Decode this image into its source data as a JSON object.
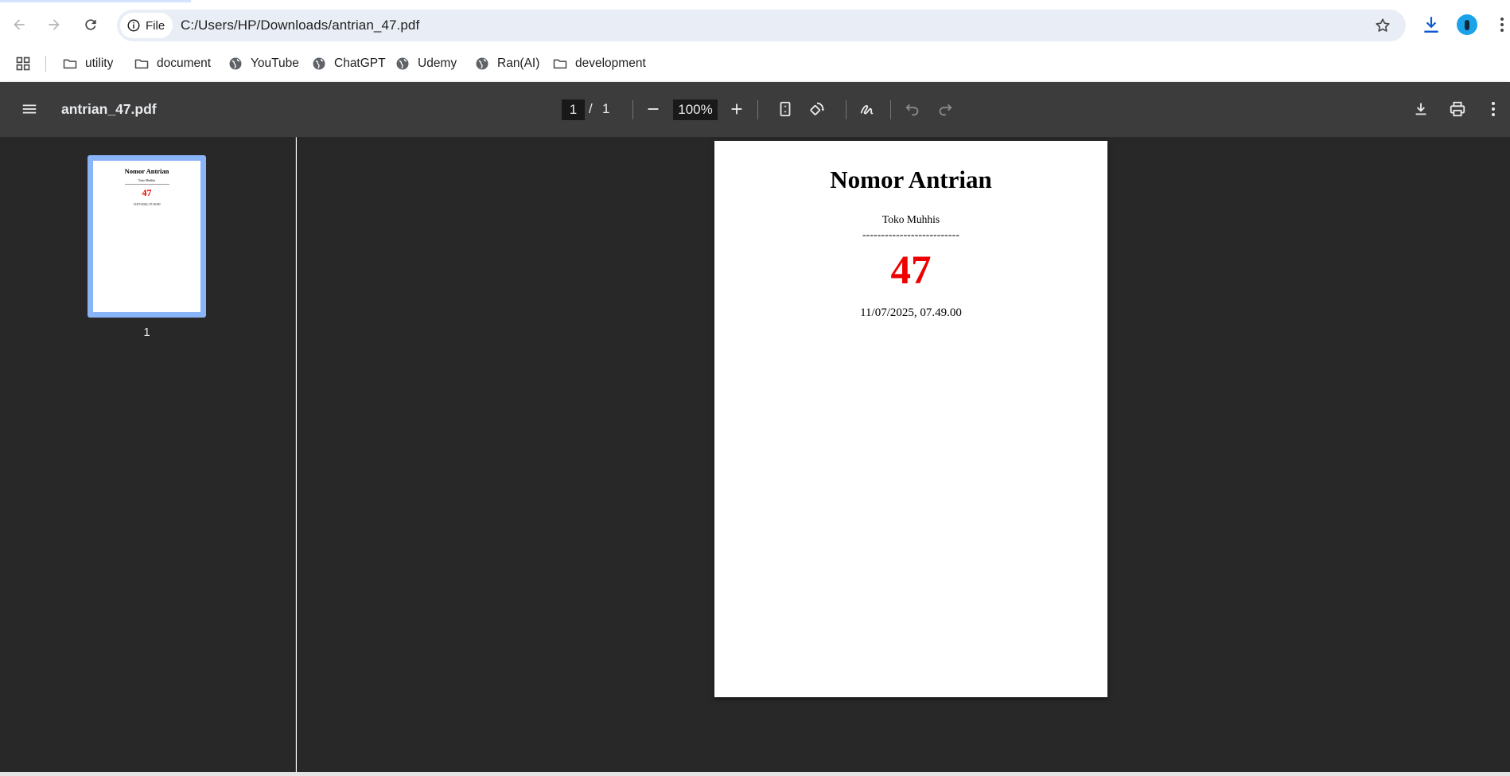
{
  "browser": {
    "site_chip_label": "File",
    "url": "C:/Users/HP/Downloads/antrian_47.pdf",
    "icons": [
      "back-arrow-icon",
      "forward-arrow-icon",
      "reload-icon",
      "info-icon",
      "star-icon",
      "download-icon",
      "avatar",
      "more-vert-icon"
    ]
  },
  "bookmarks": [
    {
      "label": "utility",
      "icon": "folder-icon"
    },
    {
      "label": "document",
      "icon": "folder-icon"
    },
    {
      "label": "YouTube",
      "icon": "globe-icon"
    },
    {
      "label": "ChatGPT",
      "icon": "globe-icon"
    },
    {
      "label": "Udemy",
      "icon": "globe-icon"
    },
    {
      "label": "Ran(AI)",
      "icon": "globe-icon"
    },
    {
      "label": "development",
      "icon": "folder-icon"
    }
  ],
  "pdf_viewer": {
    "file_name": "antrian_47.pdf",
    "current_page": "1",
    "page_separator": "/",
    "total_pages": "1",
    "zoom": "100%",
    "thumbnail_label": "1"
  },
  "document": {
    "title": "Nomor Antrian",
    "store": "Toko Muhhis",
    "separator": "--------------------------",
    "queue_number": "47",
    "timestamp": "11/07/2025, 07.49.00"
  },
  "colors": {
    "accent_blue": "#8ab4f8",
    "download_blue": "#0b57d0",
    "queue_number_red": "#ee0000",
    "viewer_background": "#282828",
    "viewer_toolbar": "#3c3c3c"
  }
}
